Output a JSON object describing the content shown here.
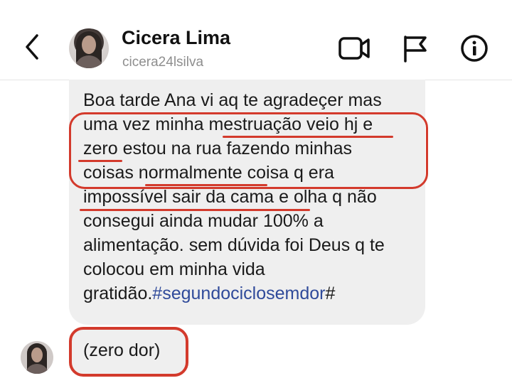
{
  "header": {
    "name": "Cicera Lima",
    "handle": "cicera24lsilva",
    "icons": {
      "back": "chevron-left-icon",
      "video": "video-camera-icon",
      "flag": "flag-icon",
      "info": "info-icon"
    }
  },
  "message": {
    "lines": [
      "Boa tarde Ana vi aq te agradeçer mas",
      "uma vez minha mestruação veio hj e",
      "zero estou na rua fazendo minhas",
      "coisas normalmente coisa q era",
      "impossível sair da cama e olha q não",
      "consegui ainda mudar 100% a",
      "alimentação. sem dúvida foi Deus q te",
      "colocou em minha vida"
    ],
    "last_line_prefix": "gratidão.",
    "hashtag": "#segundociclosemdor",
    "last_line_suffix": "#"
  },
  "reply": {
    "text": "(zero dor)"
  },
  "colors": {
    "highlight": "#d33a2c",
    "bubble": "#efefef",
    "hashtag": "#2f4a9a"
  }
}
